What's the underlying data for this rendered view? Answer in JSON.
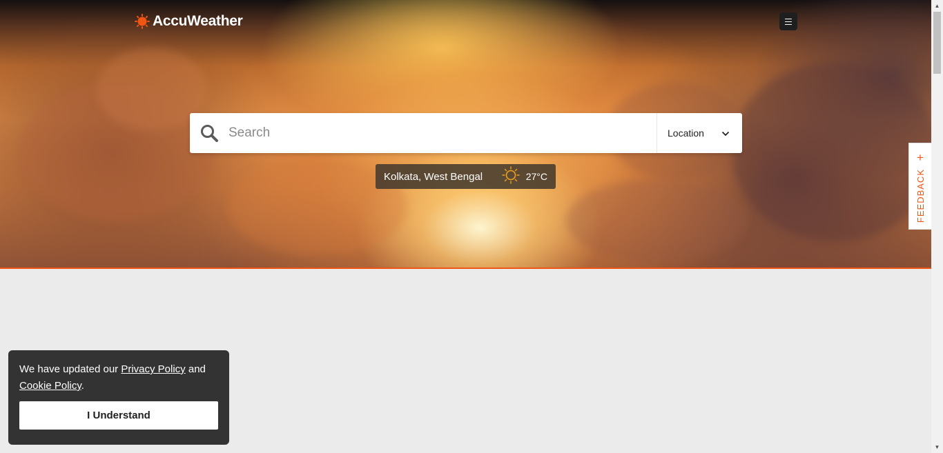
{
  "header": {
    "logo_text": "AccuWeather",
    "logo_icon": "accuweather-sun-icon",
    "menu_icon": "hamburger-menu-icon"
  },
  "search": {
    "placeholder": "Search",
    "value": "",
    "search_icon": "magnifier-icon",
    "location_label": "Location",
    "location_icon": "chevron-down-icon"
  },
  "recent_location": {
    "city": "Kolkata, West Bengal",
    "condition_icon": "sunny-icon",
    "temperature": "27°C"
  },
  "feedback": {
    "label": "FEEDBACK",
    "icon": "plus-icon"
  },
  "cookie_banner": {
    "text_before": "We have updated our ",
    "privacy_link": "Privacy Policy",
    "text_middle": " and ",
    "cookie_link": "Cookie Policy",
    "text_after": ".",
    "button_label": "I Understand"
  },
  "colors": {
    "accent": "#f05514",
    "banner_bg": "#333333",
    "page_bg": "#ebebeb"
  }
}
